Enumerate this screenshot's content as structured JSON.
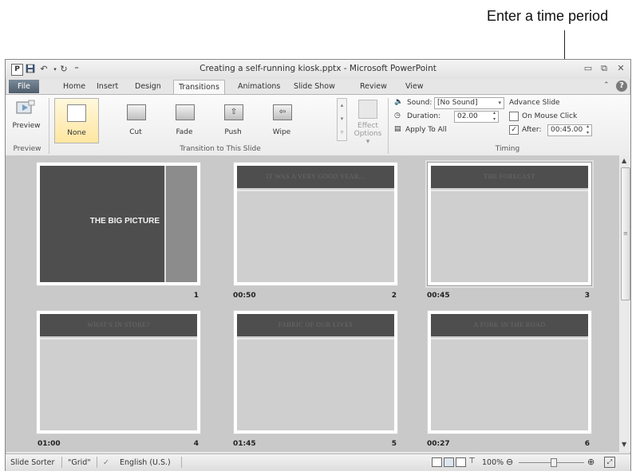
{
  "callout": {
    "text": "Enter a time period"
  },
  "window": {
    "title": "Creating a self-running kiosk.pptx - Microsoft PowerPoint",
    "app_icon": "P",
    "qat": {
      "save": "save-icon",
      "undo": "↶",
      "redo": "↻",
      "customize": "⁼"
    },
    "controls": {
      "minimize": "▭",
      "restore": "⧉",
      "close": "✕"
    }
  },
  "tabs": [
    "File",
    "Home",
    "Insert",
    "Design",
    "Transitions",
    "Animations",
    "Slide Show",
    "Review",
    "View"
  ],
  "ribbon": {
    "preview_label": "Preview",
    "preview_group": "Preview",
    "transitions": [
      "None",
      "Cut",
      "Fade",
      "Push",
      "Wipe"
    ],
    "transition_group": "Transition to This Slide",
    "effect_options": [
      "Effect",
      "Options ▾"
    ],
    "sound_label": "Sound:",
    "sound_value": "[No Sound]",
    "duration_label": "Duration:",
    "duration_value": "02.00",
    "apply_all": "Apply To All",
    "advance_title": "Advance Slide",
    "on_mouse_click": "On Mouse Click",
    "after_label": "After:",
    "after_value": "00:45.00",
    "timing_group": "Timing"
  },
  "slides": [
    {
      "num": "1",
      "time": "",
      "title": "THE BIG PICTURE"
    },
    {
      "num": "2",
      "time": "00:50",
      "title": "IT WAS A VERY GOOD YEAR..."
    },
    {
      "num": "3",
      "time": "00:45",
      "title": "THE FORECAST"
    },
    {
      "num": "4",
      "time": "01:00",
      "title": "WHAT'S IN STORE?"
    },
    {
      "num": "5",
      "time": "01:45",
      "title": "FABRIC OF OUR LIVES"
    },
    {
      "num": "6",
      "time": "00:27",
      "title": "A FORK IN THE ROAD"
    }
  ],
  "statusbar": {
    "view": "Slide Sorter",
    "theme": "\"Grid\"",
    "language": "English (U.S.)",
    "zoom": "100%"
  },
  "colors": {
    "band": "#4e4e4e",
    "sorter_bg": "#c9c9c9",
    "file_tab": "#5a6877"
  }
}
